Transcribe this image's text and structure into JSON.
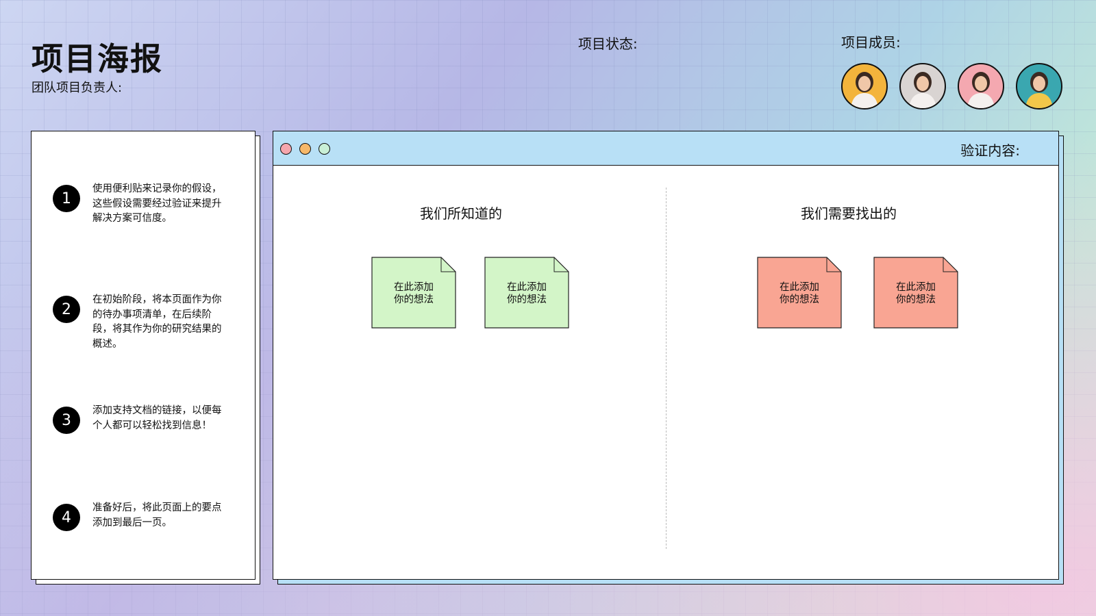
{
  "header": {
    "title": "项目海报",
    "subtitle": "团队项目负责人:",
    "status_label": "项目状态:",
    "members_label": "项目成员:"
  },
  "members": [
    {
      "icon": "person-photo-icon",
      "bg": "#f3b43c"
    },
    {
      "icon": "person-photo-icon",
      "bg": "#d9d4d2"
    },
    {
      "icon": "person-photo-icon",
      "bg": "#f4a8b0"
    },
    {
      "icon": "person-photo-icon",
      "bg": "#3aa7b0"
    }
  ],
  "steps": [
    {
      "num": "1",
      "text": "使用便利贴来记录你的假设，这些假设需要经过验证来提升解决方案可信度。"
    },
    {
      "num": "2",
      "text": "在初始阶段，将本页面作为你的待办事项清单，在后续阶段，将其作为你的研究结果的概述。"
    },
    {
      "num": "3",
      "text": "添加支持文档的链接，以便每个人都可以轻松找到信息！"
    },
    {
      "num": "4",
      "text": "准备好后，将此页面上的要点添加到最后一页。"
    }
  ],
  "board": {
    "verify_label": "验证内容:",
    "left_title": "我们所知道的",
    "right_title": "我们需要找出的",
    "note_text": "在此添加你的想法",
    "note_line1": "在此添加",
    "note_line2": "你的想法"
  },
  "colors": {
    "note_green": "#d3f5c8",
    "note_salmon": "#f9a593",
    "window_bar": "#b8e0f6"
  }
}
